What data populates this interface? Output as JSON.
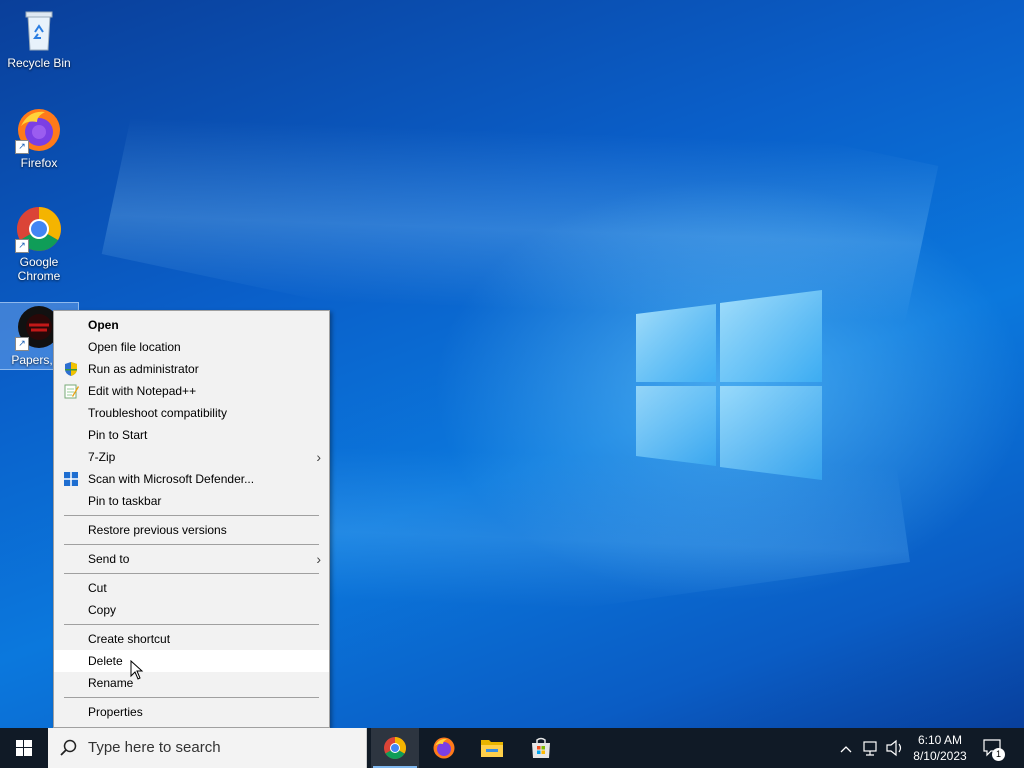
{
  "desktop": {
    "icons": [
      {
        "label": "Recycle Bin"
      },
      {
        "label": "Firefox"
      },
      {
        "label": "Google Chrome"
      },
      {
        "label": "Papers, Pl"
      }
    ]
  },
  "context_menu": {
    "items": [
      {
        "label": "Open",
        "bold": true
      },
      {
        "label": "Open file location"
      },
      {
        "label": "Run as administrator",
        "icon": "shield-icon"
      },
      {
        "label": "Edit with Notepad++",
        "icon": "notepadpp-icon"
      },
      {
        "label": "Troubleshoot compatibility"
      },
      {
        "label": "Pin to Start"
      },
      {
        "label": "7-Zip",
        "submenu": true
      },
      {
        "label": "Scan with Microsoft Defender...",
        "icon": "defender-icon"
      },
      {
        "label": "Pin to taskbar"
      },
      {
        "label": "Restore previous versions"
      },
      {
        "label": "Send to",
        "submenu": true
      },
      {
        "label": "Cut"
      },
      {
        "label": "Copy"
      },
      {
        "label": "Create shortcut"
      },
      {
        "label": "Delete",
        "hovered": true
      },
      {
        "label": "Rename"
      },
      {
        "label": "Properties"
      }
    ],
    "submenu_arrow": "›"
  },
  "taskbar": {
    "search_placeholder": "Type here to search",
    "apps": [
      "chrome-icon",
      "firefox-icon",
      "file-explorer-icon",
      "microsoft-store-icon"
    ],
    "tray": {
      "time": "6:10 AM",
      "date": "8/10/2023",
      "notification_count": "1"
    }
  },
  "colors": {
    "desktop_blue": "#0b78dd",
    "taskbar": "#101a26",
    "menu_bg": "#f2f2f2"
  }
}
